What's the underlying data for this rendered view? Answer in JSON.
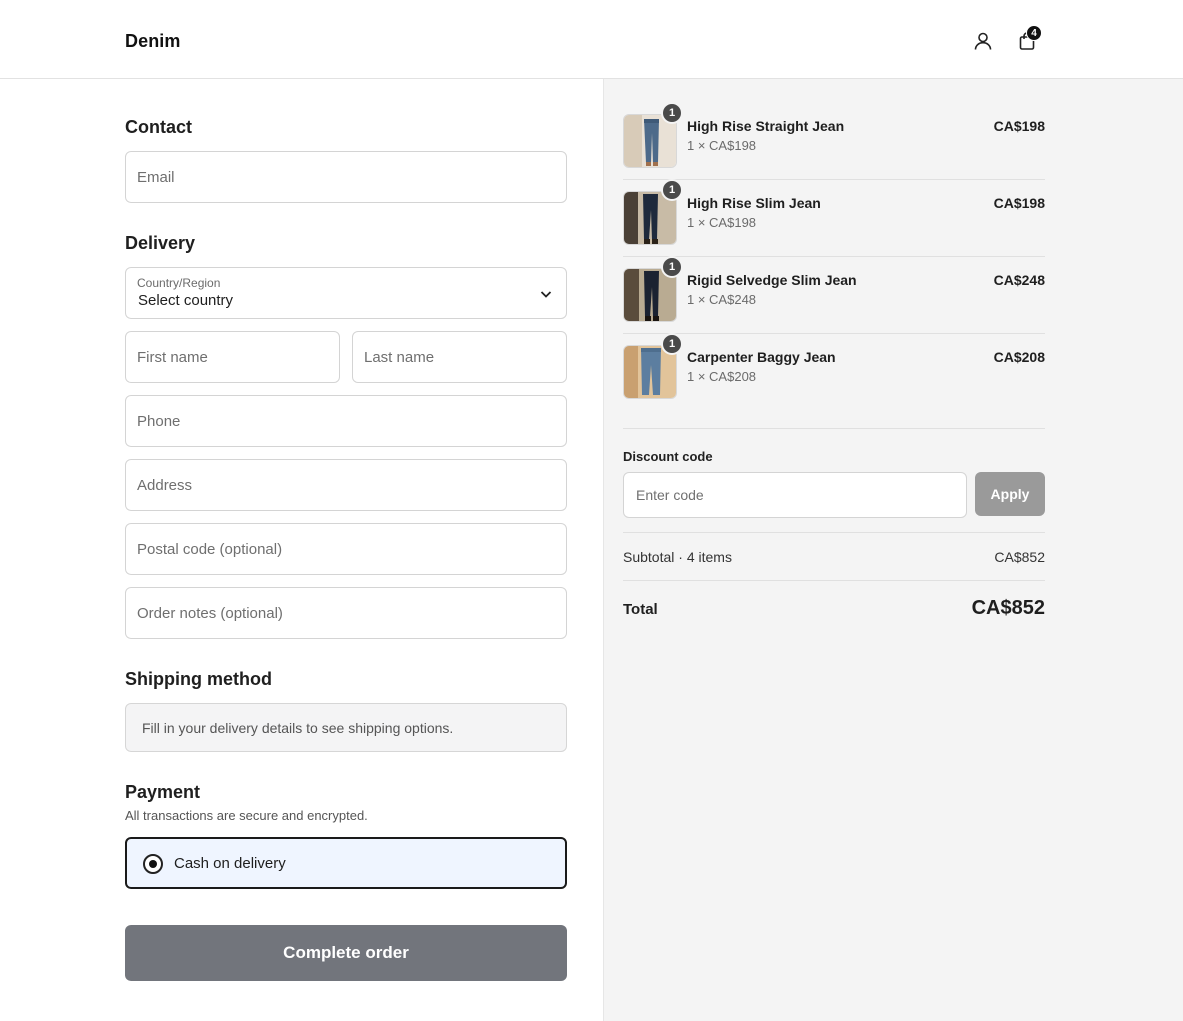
{
  "header": {
    "brand": "Denim",
    "cart_count": "4"
  },
  "contact": {
    "title": "Contact",
    "email_placeholder": "Email"
  },
  "delivery": {
    "title": "Delivery",
    "country_label": "Country/Region",
    "country_value": "Select country",
    "first_name_placeholder": "First name",
    "last_name_placeholder": "Last name",
    "phone_placeholder": "Phone",
    "address_placeholder": "Address",
    "postal_placeholder": "Postal code (optional)",
    "notes_placeholder": "Order notes (optional)"
  },
  "shipping": {
    "title": "Shipping method",
    "notice": "Fill in your delivery details to see shipping options."
  },
  "payment": {
    "title": "Payment",
    "subtitle": "All transactions are secure and encrypted.",
    "option": "Cash on delivery"
  },
  "complete_label": "Complete order",
  "items": [
    {
      "qty": "1",
      "name": "High Rise Straight Jean",
      "sub": "1 × CA$198",
      "price": "CA$198"
    },
    {
      "qty": "1",
      "name": "High Rise Slim Jean",
      "sub": "1 × CA$198",
      "price": "CA$198"
    },
    {
      "qty": "1",
      "name": "Rigid Selvedge Slim Jean",
      "sub": "1 × CA$248",
      "price": "CA$248"
    },
    {
      "qty": "1",
      "name": "Carpenter Baggy Jean",
      "sub": "1 × CA$208",
      "price": "CA$208"
    }
  ],
  "discount": {
    "label": "Discount code",
    "placeholder": "Enter code",
    "apply": "Apply"
  },
  "totals": {
    "subtotal_label": "Subtotal · 4 items",
    "subtotal_value": "CA$852",
    "total_label": "Total",
    "total_value": "CA$852"
  },
  "icons": {
    "account": "user-icon",
    "cart": "shopping-bag-icon",
    "select": "chevron-down-icon"
  }
}
